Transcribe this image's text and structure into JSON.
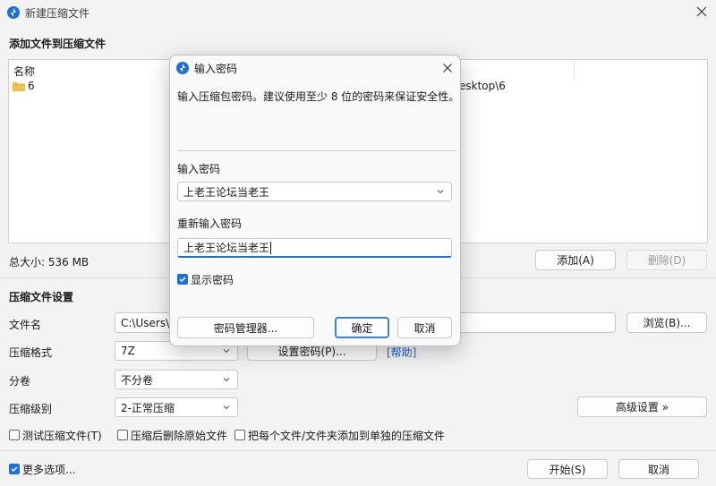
{
  "main_window": {
    "title": "新建压缩文件",
    "add_section_title": "添加文件到压缩文件",
    "list_header": "名称",
    "list_items": [
      {
        "name": "6"
      }
    ],
    "path_partial": "esktop\\6",
    "total_size": "总大小: 536 MB",
    "add_button": "添加(A)",
    "delete_button": "删除(D)",
    "settings_title": "压缩文件设置",
    "filename_label": "文件名",
    "filename_value": "C:\\Users\\w",
    "browse_button": "浏览(B)...",
    "format_label": "压缩格式",
    "format_value": "7Z",
    "set_password_button": "设置密码(P)...",
    "help_link": "[帮助]",
    "split_label": "分卷",
    "split_value": "不分卷",
    "level_label": "压缩级别",
    "level_value": "2-正常压缩",
    "advanced_button": "高级设置 »",
    "checkbox_test": "测试压缩文件(T)",
    "checkbox_delete": "压缩后删除原始文件",
    "checkbox_each": "把每个文件/文件夹添加到单独的压缩文件",
    "more_options": "更多选项...",
    "start_button": "开始(S)",
    "cancel_button": "取消"
  },
  "password_dialog": {
    "title": "输入密码",
    "hint": "输入压缩包密码。建议使用至少 8 位的密码来保证安全性。",
    "password_label": "输入密码",
    "password_value": "上老王论坛当老王",
    "reenter_label": "重新输入密码",
    "reenter_value": "上老王论坛当老王",
    "show_password_label": "显示密码",
    "show_password_checked": true,
    "manager_button": "密码管理器...",
    "ok_button": "确定",
    "cancel_button": "取消"
  },
  "icons": {
    "app": "app-logo-icon",
    "close": "close-icon",
    "folder": "folder-icon",
    "chevron": "chevron-down-icon",
    "check": "check-icon"
  },
  "colors": {
    "accent": "#1f6fd9",
    "folder": "#f2c14e",
    "link": "#1f5fd0"
  }
}
